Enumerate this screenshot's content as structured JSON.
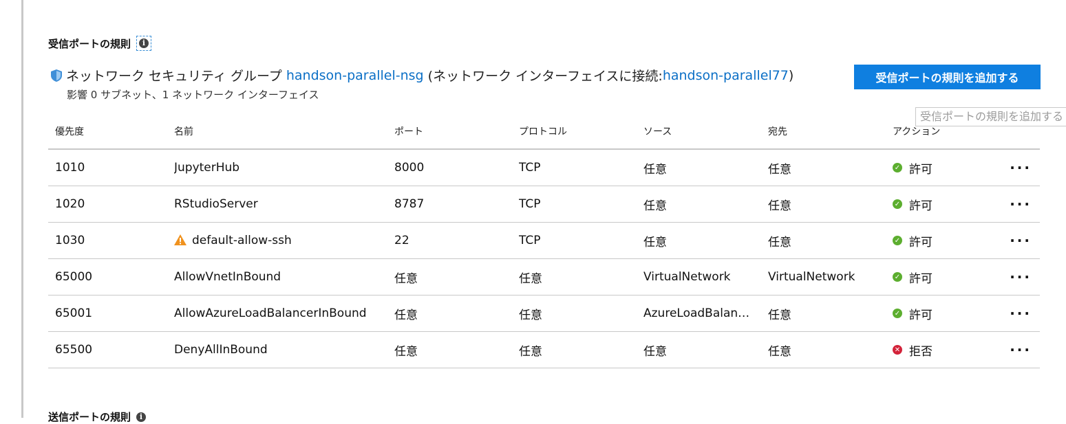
{
  "inbound": {
    "title": "受信ポートの規則",
    "nsg_label": "ネットワーク セキュリティ グループ",
    "nsg_name": "handson-parallel-nsg",
    "attached_prefix": "(ネットワーク インターフェイスに接続: ",
    "nic_name": "handson-parallel77",
    "attached_suffix": ")",
    "impact": "影響 0 サブネット、1 ネットワーク インターフェイス",
    "add_button": "受信ポートの規則を追加する",
    "tooltip": "受信ポートの規則を追加する",
    "columns": [
      "優先度",
      "名前",
      "ポート",
      "プロトコル",
      "ソース",
      "宛先",
      "アクション"
    ],
    "rules": [
      {
        "priority": "1010",
        "name": "JupyterHub",
        "port": "8000",
        "protocol": "TCP",
        "source": "任意",
        "destination": "任意",
        "action": "許可"
      },
      {
        "priority": "1020",
        "name": "RStudioServer",
        "port": "8787",
        "protocol": "TCP",
        "source": "任意",
        "destination": "任意",
        "action": "許可"
      },
      {
        "priority": "1030",
        "name": "default-allow-ssh",
        "port": "22",
        "protocol": "TCP",
        "source": "任意",
        "destination": "任意",
        "action": "許可"
      },
      {
        "priority": "65000",
        "name": "AllowVnetInBound",
        "port": "任意",
        "protocol": "任意",
        "source": "VirtualNetwork",
        "destination": "VirtualNetwork",
        "action": "許可"
      },
      {
        "priority": "65001",
        "name": "AllowAzureLoadBalancerInBound",
        "port": "任意",
        "protocol": "任意",
        "source": "AzureLoadBalan…",
        "destination": "任意",
        "action": "許可"
      },
      {
        "priority": "65500",
        "name": "DenyAllInBound",
        "port": "任意",
        "protocol": "任意",
        "source": "任意",
        "destination": "任意",
        "action": "拒否"
      }
    ],
    "more_label": "···"
  },
  "outbound": {
    "title": "送信ポートの規則"
  },
  "colors": {
    "accent": "#0f7fe0",
    "link": "#0b6fc6",
    "allow": "#5cae2f",
    "deny": "#d3233a",
    "warning": "#f0921e"
  },
  "icons": {
    "info": "info-icon",
    "shield": "shield-icon",
    "warning": "warning-icon",
    "allow": "check-circle-icon",
    "deny": "x-circle-icon"
  }
}
